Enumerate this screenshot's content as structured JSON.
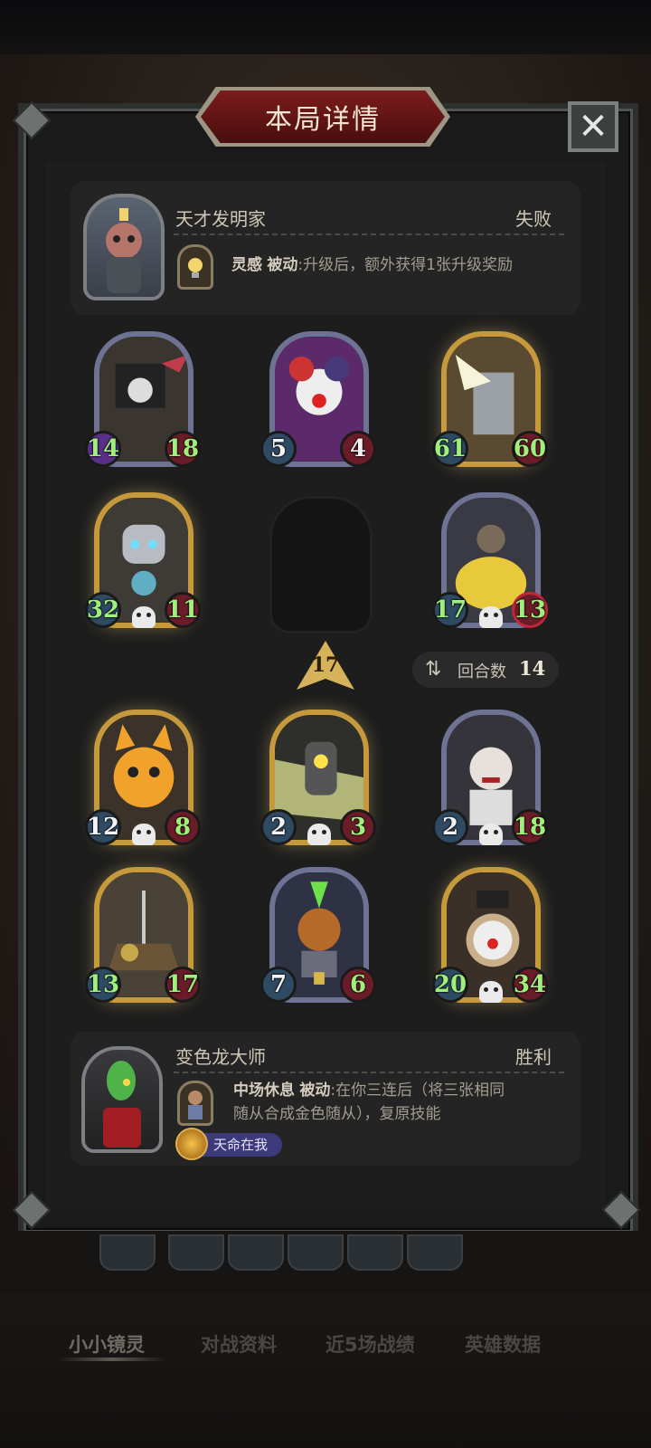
{
  "title": "本局详情",
  "close_icon": "close-icon",
  "opponent": {
    "name": "天才发明家",
    "result": "失败",
    "skill_name": "灵感",
    "skill_type": "被动",
    "skill_desc": ":升级后，额外获得1张升级奖励"
  },
  "player": {
    "name": "变色龙大师",
    "result": "胜利",
    "skill_name": "中场休息",
    "skill_type": "被动",
    "skill_desc_line1": ":在你三连后（将三张相同",
    "skill_desc_line2": "随从合成金色随从），复原技能",
    "badge": "天命在我"
  },
  "opponent_board": [
    {
      "atk": "14",
      "hp": "18",
      "tier": "silver"
    },
    {
      "atk": "5",
      "hp": "4",
      "tier": "silver"
    },
    {
      "atk": "61",
      "hp": "60",
      "tier": "gold"
    },
    {
      "atk": "32",
      "hp": "11",
      "tier": "gold"
    },
    {
      "atk": "17",
      "hp": "13",
      "tier": "silver"
    }
  ],
  "tavern_level": "17",
  "round": {
    "label": "回合数",
    "value": "14"
  },
  "player_board": [
    {
      "atk": "12",
      "hp": "8",
      "tier": "gold"
    },
    {
      "atk": "2",
      "hp": "3",
      "tier": "gold"
    },
    {
      "atk": "2",
      "hp": "18",
      "tier": "silver"
    },
    {
      "atk": "13",
      "hp": "17",
      "tier": "gold"
    },
    {
      "atk": "7",
      "hp": "6",
      "tier": "silver"
    },
    {
      "atk": "20",
      "hp": "34",
      "tier": "gold"
    }
  ],
  "tabs": [
    "小小镜灵",
    "对战资料",
    "近5场战绩",
    "英雄数据"
  ]
}
